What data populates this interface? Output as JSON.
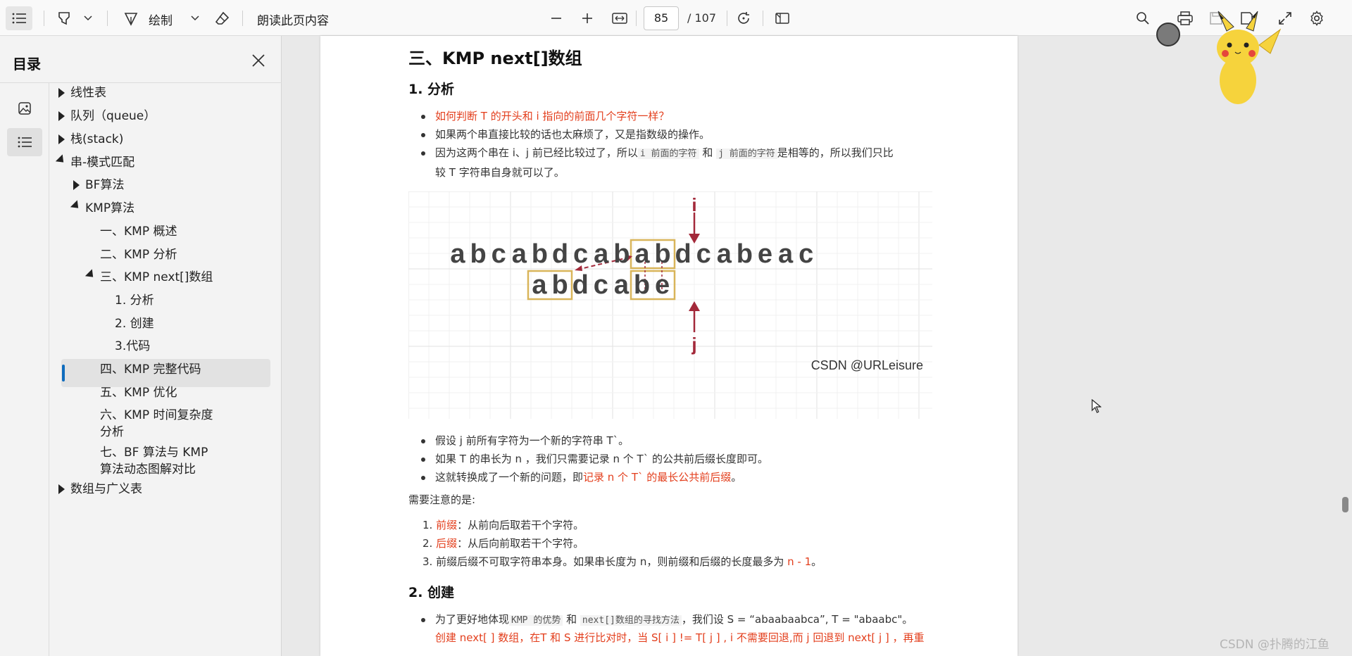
{
  "toolbar": {
    "draw_label": "绘制",
    "read_aloud_label": "朗读此页内容",
    "page_current": "85",
    "page_total": "/ 107"
  },
  "sidebar": {
    "title": "目录",
    "toc": [
      {
        "label": "线性表",
        "level": 0,
        "state": "collapsed"
      },
      {
        "label": "队列（queue）",
        "level": 0,
        "state": "collapsed"
      },
      {
        "label": "栈(stack)",
        "level": 0,
        "state": "collapsed"
      },
      {
        "label": "串-模式匹配",
        "level": 0,
        "state": "expanded"
      },
      {
        "label": "BF算法",
        "level": 1,
        "state": "collapsed"
      },
      {
        "label": "KMP算法",
        "level": 1,
        "state": "expanded"
      },
      {
        "label": "一、KMP 概述",
        "level": 2,
        "state": "leaf"
      },
      {
        "label": "二、KMP 分析",
        "level": 2,
        "state": "leaf"
      },
      {
        "label": "三、KMP next[]数组",
        "level": 2,
        "state": "expanded",
        "selected": true
      },
      {
        "label": "1. 分析",
        "level": 3,
        "state": "leaf"
      },
      {
        "label": "2. 创建",
        "level": 3,
        "state": "leaf"
      },
      {
        "label": "3.代码",
        "level": 3,
        "state": "leaf"
      },
      {
        "label": "四、KMP 完整代码",
        "level": 2,
        "state": "leaf"
      },
      {
        "label": "五、KMP 优化",
        "level": 2,
        "state": "leaf"
      },
      {
        "label": "六、KMP 时间复杂度分析",
        "level": 2,
        "state": "leaf"
      },
      {
        "label": "七、BF 算法与 KMP 算法动态图解对比",
        "level": 2,
        "state": "leaf"
      },
      {
        "label": "数组与广义表",
        "level": 0,
        "state": "collapsed"
      }
    ]
  },
  "doc": {
    "heading": "三、KMP next[]数组",
    "sub1": "1. 分析",
    "b1": "如何判断 T 的开头和 i 指向的前面几个字符一样？",
    "b2": "如果两个串直接比较的话也太麻烦了，又是指数级的操作。",
    "b3_a": "因为这两个串在 i、j 前已经比较过了，所以",
    "b3_code1": "i 前面的字符",
    "b3_and": "和",
    "b3_code2": "j 前面的字符",
    "b3_b": "是相等的，所以我们只比",
    "b3_c": "较 T 字符串自身就可以了。",
    "b4": "假设 j 前所有字符为一个新的字符串 T`。",
    "b5": "如果 T 的串长为 n ，我们只需要记录 n 个 T` 的公共前后缀长度即可。",
    "b6_a": "这就转换成了一个新的问题，即",
    "b6_red": "记录 n 个 T` 的最长公共前后缀",
    "b6_b": "。",
    "note": "需要注意的是:",
    "n1_red": "前缀",
    "n1": "：从前向后取若干个字符。",
    "n2_red": "后缀",
    "n2": "：从后向前取若干个字符。",
    "n3_a": "前缀后缀不可取字符串本身。如果串长度为 n，则前缀和后缀的长度最多为",
    "n3_red": "n - 1",
    "n3_b": "。",
    "sub2": "2. 创建",
    "c1_a": "为了更好地体现",
    "c1_code1": "KMP 的优势",
    "c1_and": "和",
    "c1_code2": "next[]数组的寻找方法",
    "c1_b": "，我们设 S = “abaabaabca”, T = \"abaabc\"。",
    "c2": "创建 next[ ] 数组，在T 和 S 进行比对时，当 S[ i ] != T[ j ] , i 不需要回退,而 j 回退到 next[ j ] ，再重"
  },
  "figure": {
    "top_string": [
      "a",
      "b",
      "c",
      "a",
      "b",
      "d",
      "c",
      "a",
      "b",
      "a",
      "b",
      "d",
      "c",
      "a",
      "b",
      "e",
      "a",
      "c"
    ],
    "bottom_string": [
      "a",
      "b",
      "d",
      "c",
      "a",
      "b",
      "e"
    ],
    "i_label": "i",
    "j_label": "j",
    "credit": "CSDN @URLeisure"
  },
  "watermark": "CSDN @扑腾的江鱼",
  "colors": {
    "accent": "#0f6cbd",
    "red_text": "#e33e1c",
    "figure_red": "#a3293a",
    "figure_box": "#d9b55a"
  }
}
